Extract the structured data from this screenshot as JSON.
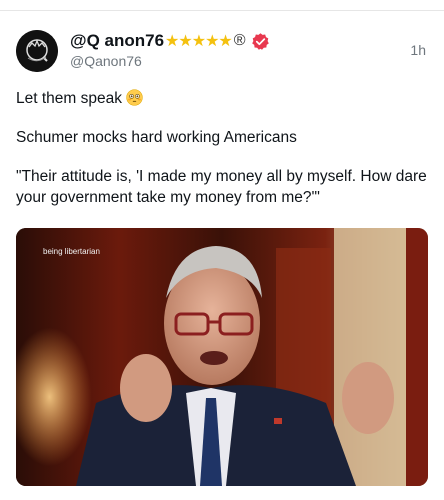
{
  "post": {
    "display_name": "@Q anon76",
    "stars": "★★★★★",
    "registered_mark": "®",
    "handle": "@Qanon76",
    "time": "1h",
    "text_line1": "Let them speak",
    "text_line2": "Schumer mocks hard working Americans",
    "text_line3": "\"Their attitude is, 'I made my money all by myself. How dare your government take my money from me?'\"",
    "media_caption": "being libertarian"
  },
  "icons": {
    "avatar": "q-avatar-icon",
    "verified": "verified-badge-icon",
    "emoji": "flushed-face-emoji-icon"
  },
  "colors": {
    "verified_badge": "#e8384f",
    "stars": "#f4c10f",
    "secondary_text": "#6e767d"
  }
}
